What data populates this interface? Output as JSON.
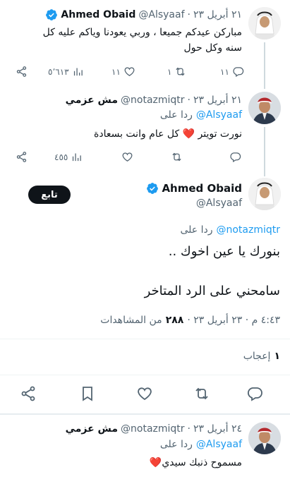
{
  "tweet1": {
    "name": "Ahmed Obaid",
    "handle": "@Alsyaaf",
    "date": "٢١ أبريل ٢٣",
    "text_line1": "مباركن عيدكم جميعا ، وربي يعودنا وياكم عليه كل",
    "text_line2": "سنه وكل حول",
    "views": "٥٬٦١٣",
    "likes": "١١",
    "retweets": "١",
    "replies": "١١"
  },
  "tweet2": {
    "name": "مش عزمي",
    "handle": "@notazmiqtr",
    "date": "٢١ أبريل ٢٣",
    "reply_prefix": "ردا على",
    "reply_to": "@Alsyaaf",
    "text": "نورت تويتر ❤️ كل عام وانت بسعادة",
    "views": "٤٥٥"
  },
  "main": {
    "name": "Ahmed Obaid",
    "handle": "@Alsyaaf",
    "follow_label": "تابع",
    "reply_prefix": "ردا على",
    "reply_to": "@notazmiqtr",
    "text_line1": "بنورك يا عين اخوك ..",
    "text_line2": "سامحني على الرد المتاخر",
    "timestamp": "٤:٤٣ م · ٢٣ أبريل ٢٣ ·",
    "views_count": "٢٨٨",
    "views_label": "من المشاهدات",
    "likes_count": "١",
    "likes_label": "إعجاب"
  },
  "tweet3": {
    "name": "مش عزمي",
    "handle": "@notazmiqtr",
    "date": "٢٤ أبريل ٢٣",
    "reply_prefix": "ردا على",
    "reply_to": "@Alsyaaf",
    "text": "مسموح ذنبك سيدي❤️"
  },
  "dot": "·",
  "colors": {
    "accent": "#1d9bf0",
    "text": "#0f1419",
    "muted": "#536471",
    "follow_bg": "#0f1419",
    "heart": "#e0245e"
  }
}
